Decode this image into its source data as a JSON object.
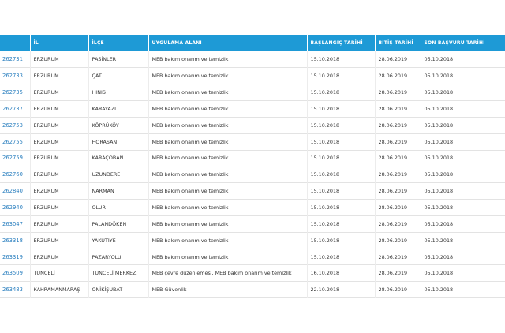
{
  "table": {
    "headers": [
      "",
      "İL",
      "İLÇE",
      "UYGULAMA ALANI",
      "BAŞLANGIÇ TARİHİ",
      "BİTİŞ TARİHİ",
      "SON BAŞVURU TARİHİ"
    ],
    "rows": [
      [
        "262731",
        "ERZURUM",
        "PASİNLER",
        "MEB bakım onarım ve temizlik",
        "15.10.2018",
        "28.06.2019",
        "05.10.2018"
      ],
      [
        "262733",
        "ERZURUM",
        "ÇAT",
        "MEB bakım onarım ve temizlik",
        "15.10.2018",
        "28.06.2019",
        "05.10.2018"
      ],
      [
        "262735",
        "ERZURUM",
        "HINIS",
        "MEB bakım onarım ve temizlik",
        "15.10.2018",
        "28.06.2019",
        "05.10.2018"
      ],
      [
        "262737",
        "ERZURUM",
        "KARAYAZI",
        "MEB bakım onarım ve temizlik",
        "15.10.2018",
        "28.06.2019",
        "05.10.2018"
      ],
      [
        "262753",
        "ERZURUM",
        "KÖPRÜKÖY",
        "MEB bakım onarım ve temizlik",
        "15.10.2018",
        "28.06.2019",
        "05.10.2018"
      ],
      [
        "262755",
        "ERZURUM",
        "HORASAN",
        "MEB bakım onarım ve temizlik",
        "15.10.2018",
        "28.06.2019",
        "05.10.2018"
      ],
      [
        "262759",
        "ERZURUM",
        "KARAÇOBAN",
        "MEB bakım onarım ve temizlik",
        "15.10.2018",
        "28.06.2019",
        "05.10.2018"
      ],
      [
        "262760",
        "ERZURUM",
        "UZUNDERE",
        "MEB bakım onarım ve temizlik",
        "15.10.2018",
        "28.06.2019",
        "05.10.2018"
      ],
      [
        "262840",
        "ERZURUM",
        "NARMAN",
        "MEB bakım onarım ve temizlik",
        "15.10.2018",
        "28.06.2019",
        "05.10.2018"
      ],
      [
        "262940",
        "ERZURUM",
        "OLUR",
        "MEB bakım onarım ve temizlik",
        "15.10.2018",
        "28.06.2019",
        "05.10.2018"
      ],
      [
        "263047",
        "ERZURUM",
        "PALANDÖKEN",
        "MEB bakım onarım ve temizlik",
        "15.10.2018",
        "28.06.2019",
        "05.10.2018"
      ],
      [
        "263318",
        "ERZURUM",
        "YAKUTİYE",
        "MEB bakım onarım ve temizlik",
        "15.10.2018",
        "28.06.2019",
        "05.10.2018"
      ],
      [
        "263319",
        "ERZURUM",
        "PAZARYOLU",
        "MEB bakım onarım ve temizlik",
        "15.10.2018",
        "28.06.2019",
        "05.10.2018"
      ],
      [
        "263509",
        "TUNCELİ",
        "TUNCELİ MERKEZ",
        "MEB çevre düzenlemesi, MEB bakım onarım ve temizlik",
        "16.10.2018",
        "28.06.2019",
        "05.10.2018"
      ],
      [
        "263483",
        "KAHRAMANMARAŞ",
        "ONİKİŞUBAT",
        "MEB Güvenlik",
        "22.10.2018",
        "28.06.2019",
        "05.10.2018"
      ]
    ]
  },
  "colors": {
    "header_bg": "#1e9ad6",
    "header_text": "#ffffff",
    "link": "#2a7fbf",
    "text": "#333333"
  }
}
